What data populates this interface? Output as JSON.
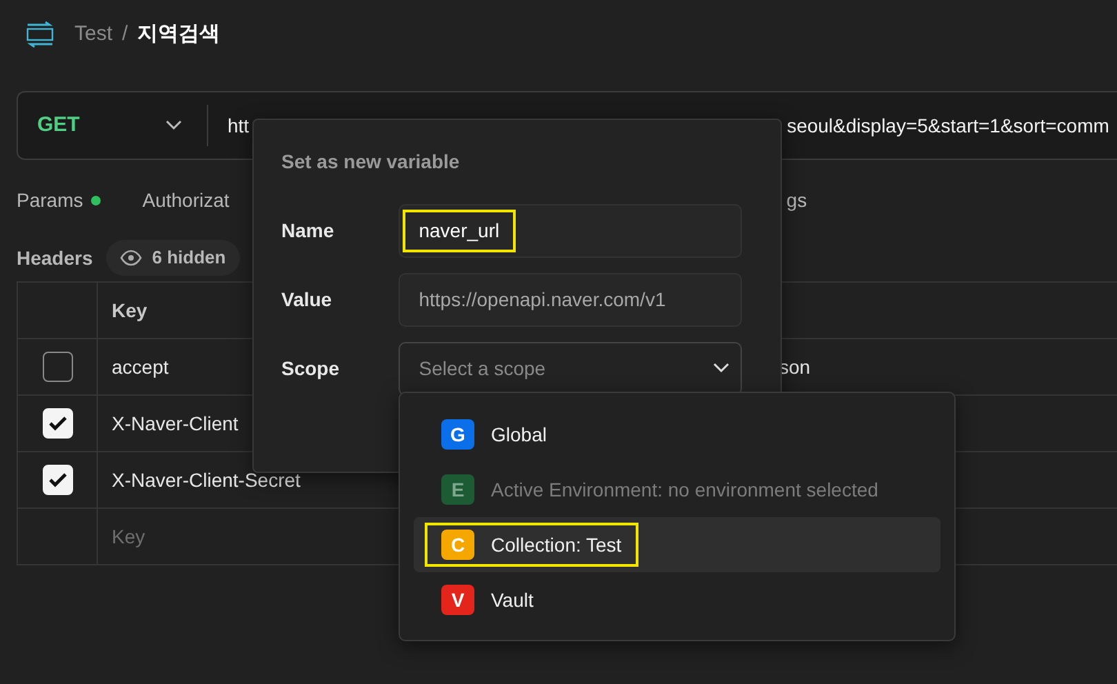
{
  "header": {
    "parent": "Test",
    "separator": "/",
    "title": "지역검색"
  },
  "request": {
    "method": "GET",
    "url_start": "htt",
    "url_end": "seoul&display=5&start=1&sort=comm"
  },
  "tabs": [
    {
      "label": "Params",
      "has_content": true
    },
    {
      "label": "Authorizat",
      "has_content": false
    },
    {
      "label": "gs",
      "has_content": false
    }
  ],
  "headers": {
    "title": "Headers",
    "hidden": "6 hidden"
  },
  "table": {
    "columns": [
      "Key"
    ],
    "rows": [
      {
        "checked": false,
        "key": "accept",
        "value": "son"
      },
      {
        "checked": true,
        "key": "X-Naver-Client"
      },
      {
        "checked": true,
        "key": "X-Naver-Client-Secret"
      }
    ],
    "new_row_placeholder": "Key"
  },
  "popup": {
    "title": "Set as new variable",
    "fields": [
      {
        "label": "Name",
        "kind": "text",
        "value": "naver_url",
        "highlighted": true
      },
      {
        "label": "Value",
        "kind": "text",
        "value": "https://openapi.naver.com/v1",
        "highlighted": false
      },
      {
        "label": "Scope",
        "kind": "select",
        "placeholder": "Select a scope"
      }
    ]
  },
  "scope_menu": [
    {
      "letter": "G",
      "label": "Global",
      "color": "#0b6fe9",
      "disabled": false,
      "selected": false,
      "highlighted": false
    },
    {
      "letter": "E",
      "label": "Active Environment: no environment selected",
      "color": "#1d5b34",
      "disabled": true,
      "selected": false,
      "highlighted": false
    },
    {
      "letter": "C",
      "label": "Collection: Test",
      "color": "#f5a700",
      "disabled": false,
      "selected": true,
      "highlighted": true
    },
    {
      "letter": "V",
      "label": "Vault",
      "color": "#e4251b",
      "disabled": false,
      "selected": false,
      "highlighted": false
    }
  ]
}
